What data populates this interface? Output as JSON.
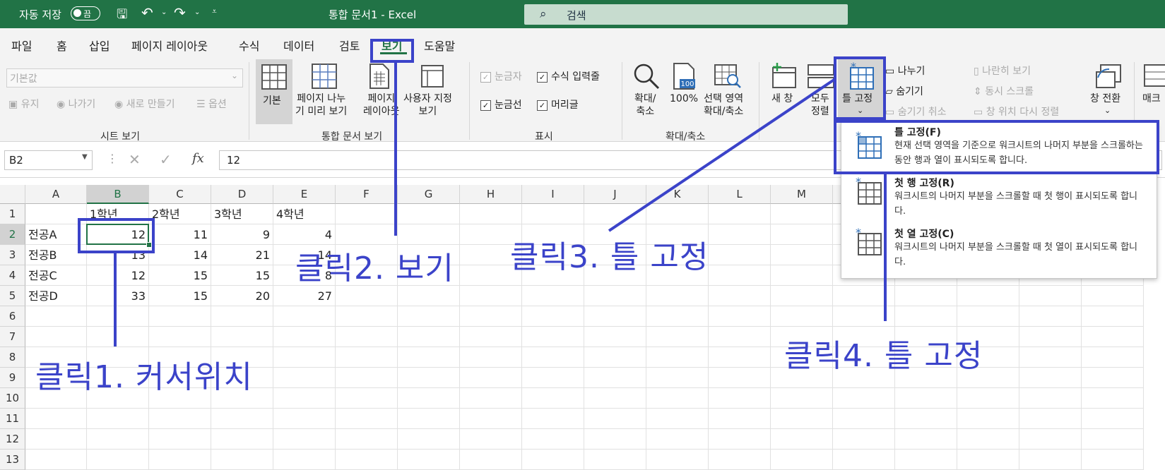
{
  "titlebar": {
    "autosave_label": "자동 저장",
    "autosave_state": "끔",
    "doc_title": "통합 문서1  -  Excel",
    "search_placeholder": "검색"
  },
  "tabs": [
    "파일",
    "홈",
    "삽입",
    "페이지 레이아웃",
    "수식",
    "데이터",
    "검토",
    "보기",
    "도움말"
  ],
  "active_tab": "보기",
  "ribbon": {
    "sheet_view": {
      "dropdown_value": "기본값",
      "keep": "유지",
      "exit": "나가기",
      "new": "새로 만들기",
      "options": "옵션",
      "group_label": "시트 보기"
    },
    "workbook_views": {
      "normal": "기본",
      "page_break_l1": "페이지 나누",
      "page_break_l2": "기 미리 보기",
      "page_layout_l1": "페이지",
      "page_layout_l2": "레이아웃",
      "custom_l1": "사용자 지정",
      "custom_l2": "보기",
      "group_label": "통합 문서 보기"
    },
    "show": {
      "ruler": "눈금자",
      "formula_bar": "수식 입력줄",
      "gridlines": "눈금선",
      "headings": "머리글",
      "group_label": "표시"
    },
    "zoom": {
      "zoom_l1": "확대/",
      "zoom_l2": "축소",
      "hundred": "100%",
      "zoom_sel_l1": "선택 영역",
      "zoom_sel_l2": "확대/축소",
      "group_label": "확대/축소"
    },
    "window": {
      "new_window": "새 창",
      "arrange_l1": "모두",
      "arrange_l2": "정렬",
      "freeze": "틀 고정",
      "split": "나누기",
      "hide": "숨기기",
      "unhide": "숨기기 취소",
      "side_by_side": "나란히 보기",
      "sync_scroll": "동시 스크롤",
      "reset_pos": "창 위치 다시 정렬",
      "switch": "창 전환",
      "macro": "매크"
    }
  },
  "formula_bar": {
    "name_box": "B2",
    "fx": "fx",
    "value": "12"
  },
  "columns": [
    "A",
    "B",
    "C",
    "D",
    "E",
    "F",
    "G",
    "H",
    "I",
    "J",
    "K",
    "L",
    "M"
  ],
  "rows": [
    "1",
    "2",
    "3",
    "4",
    "5",
    "6",
    "7",
    "8",
    "9",
    "10",
    "11",
    "12",
    "13"
  ],
  "cells": {
    "B1": "1학년",
    "C1": "2학년",
    "D1": "3학년",
    "E1": "4학년",
    "A2": "전공A",
    "B2": "12",
    "C2": "11",
    "D2": "9",
    "E2": "4",
    "A3": "전공B",
    "B3": "13",
    "C3": "14",
    "D3": "21",
    "E3": "14",
    "A4": "전공C",
    "B4": "12",
    "C4": "15",
    "D4": "15",
    "E4": "8",
    "A5": "전공D",
    "B5": "33",
    "C5": "15",
    "D5": "20",
    "E5": "27"
  },
  "freeze_menu": {
    "item1_title": "틀 고정(F)",
    "item1_desc": "현재 선택 영역을 기준으로 워크시트의 나머지 부분을 스크롤하는 동안 행과 열이 표시되도록 합니다.",
    "item2_title": "첫 행 고정(R)",
    "item2_desc": "워크시트의 나머지 부분을 스크롤할 때 첫 행이 표시되도록 합니다.",
    "item3_title": "첫 열 고정(C)",
    "item3_desc": "워크시트의 나머지 부분을 스크롤할 때 첫 열이 표시되도록 합니다."
  },
  "annotations": {
    "step1": "클릭1. 커서위치",
    "step2": "클릭2. 보기",
    "step3": "클릭3. 틀 고정",
    "step4": "클릭4. 틀 고정"
  },
  "colors": {
    "excel_green": "#217346",
    "annotation_blue": "#3b43c9"
  }
}
